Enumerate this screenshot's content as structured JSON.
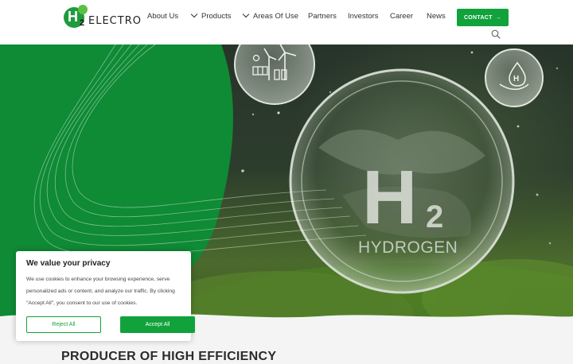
{
  "logo": {
    "h": "H",
    "sub": "2",
    "word": "ELECTRO"
  },
  "nav": {
    "about": "About Us",
    "products": "Products",
    "areas": "Areas Of Use",
    "partners": "Partners",
    "investors": "Investors",
    "career": "Career",
    "news": "News"
  },
  "contact": {
    "label": "CONTACT",
    "arrow": "→"
  },
  "hero": {
    "h": "H",
    "sub": "2",
    "word": "HYDROGEN",
    "bubble_h": "H"
  },
  "section": {
    "heading": "PRODUCER OF HIGH EFFICIENCY"
  },
  "cookie": {
    "title": "We value your privacy",
    "text": "We use cookies to enhance your browsing experience, serve personalized ads or content, and analyze our traffic. By clicking \"Accept All\", you consent to our use of cookies.",
    "reject": "Reject All",
    "accept": "Accept All"
  },
  "colors": {
    "brand_green": "#11a23b",
    "hero_green": "#0f8a35"
  }
}
